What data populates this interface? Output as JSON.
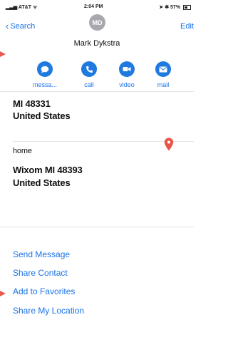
{
  "status_bar": {
    "carrier": "AT&T",
    "time": "2:04 PM",
    "battery": "57%"
  },
  "nav": {
    "back_label": "Search",
    "edit_label": "Edit"
  },
  "contact": {
    "initials": "MD",
    "name": "Mark Dykstra"
  },
  "actions": [
    {
      "label": "messa...",
      "icon": "message-bubble-icon"
    },
    {
      "label": "call",
      "icon": "phone-icon"
    },
    {
      "label": "video",
      "icon": "video-camera-icon"
    },
    {
      "label": "mail",
      "icon": "envelope-icon"
    }
  ],
  "address_1": {
    "line1": "MI 48331",
    "line2": "United States"
  },
  "address_2": {
    "label": "home",
    "line1": "Wixom MI 48393",
    "line2": "United States"
  },
  "links": [
    "Send Message",
    "Share Contact",
    "Add to Favorites",
    "Share My Location"
  ],
  "colors": {
    "accent": "#1a73e8",
    "button_fill": "#1f7ae0",
    "pin": "#e8564a",
    "annotation": "#e85a4f"
  }
}
